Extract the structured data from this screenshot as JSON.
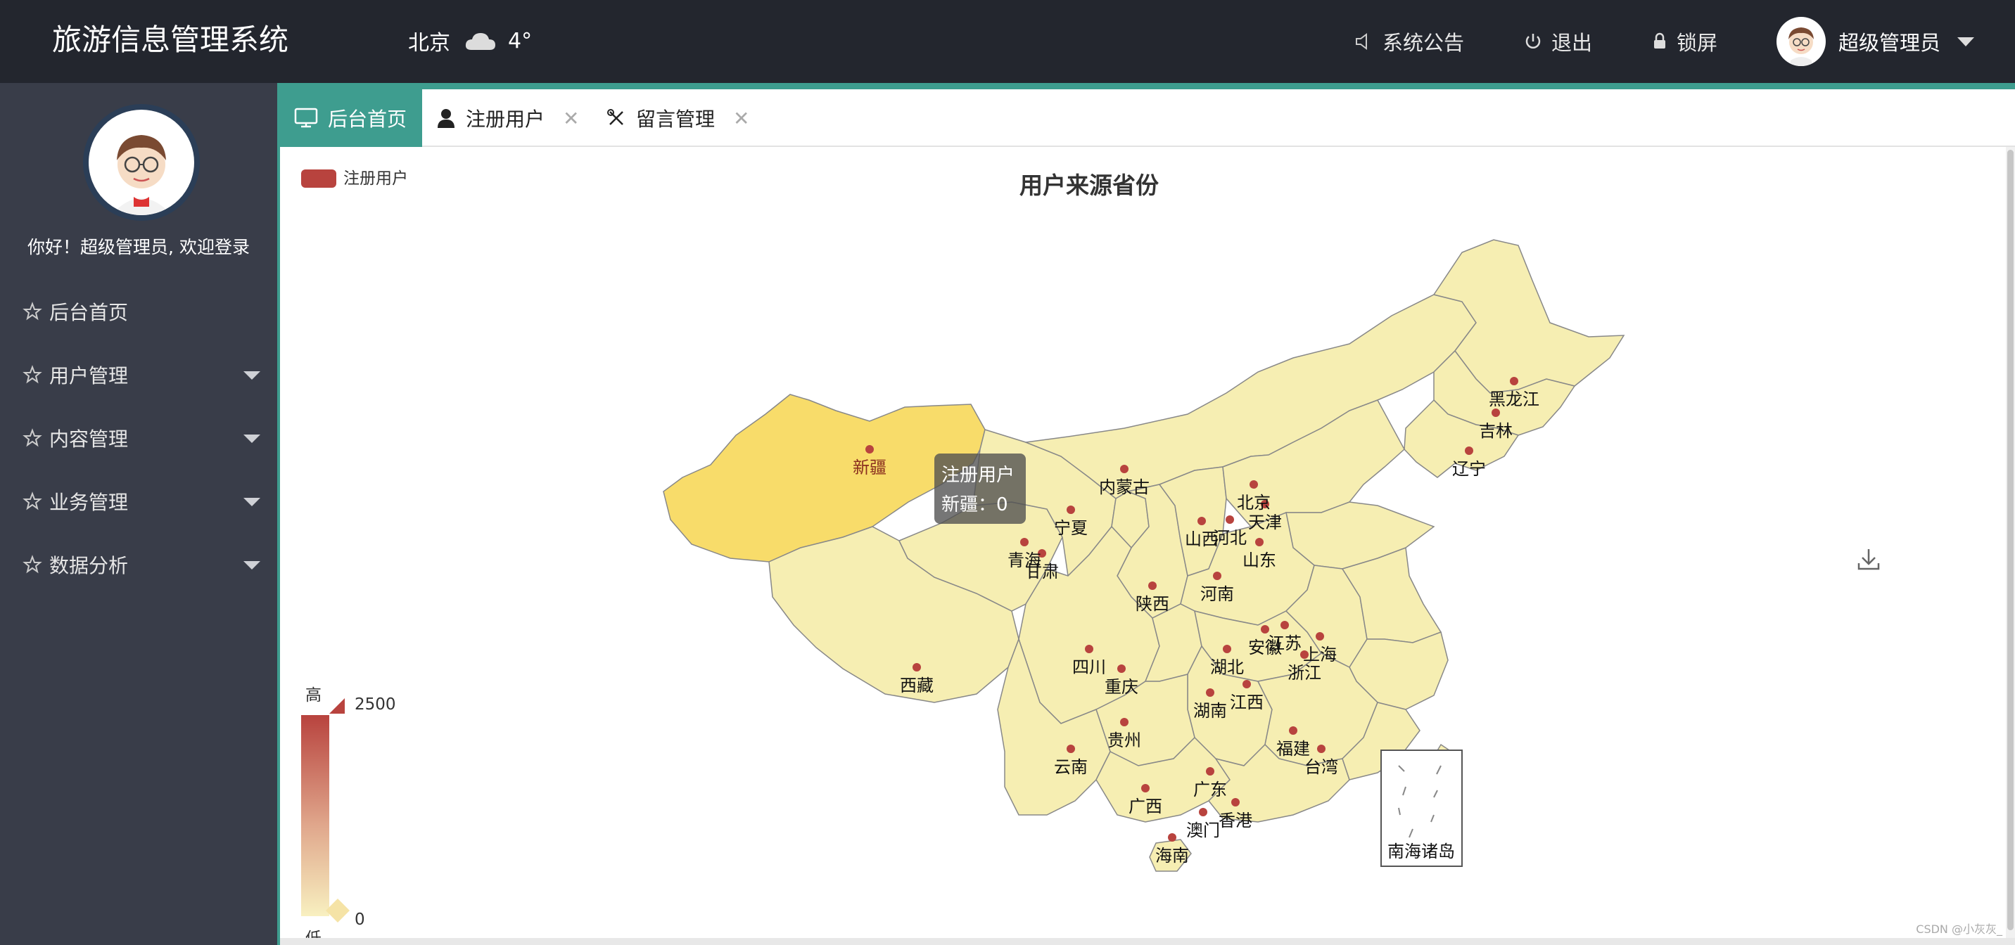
{
  "header": {
    "brand": "旅游信息管理系统",
    "city": "北京",
    "temperature": "4°",
    "weather_icon": "cloud-icon",
    "links": {
      "announcement": "系统公告",
      "logout": "退出",
      "lock": "锁屏"
    },
    "user_name": "超级管理员"
  },
  "sidebar": {
    "welcome": "你好！超级管理员, 欢迎登录",
    "items": [
      {
        "label": "后台首页",
        "has_submenu": false
      },
      {
        "label": "用户管理",
        "has_submenu": true
      },
      {
        "label": "内容管理",
        "has_submenu": true
      },
      {
        "label": "业务管理",
        "has_submenu": true
      },
      {
        "label": "数据分析",
        "has_submenu": true
      }
    ]
  },
  "tabs": [
    {
      "label": "后台首页",
      "active": true,
      "closable": false
    },
    {
      "label": "注册用户",
      "active": false,
      "closable": true
    },
    {
      "label": "留言管理",
      "active": false,
      "closable": true
    }
  ],
  "colors": {
    "accent": "#3e9d8f",
    "header_bg": "#23262e",
    "sidebar_bg": "#393d49",
    "series": "#b8433e",
    "region_fill": "#f5eeb0",
    "region_highlight": "#f8dc6a"
  },
  "chart_data": {
    "type": "map",
    "title": "用户来源省份",
    "legend": [
      "注册用户"
    ],
    "series": [
      {
        "name": "注册用户",
        "data": [
          {
            "name": "新疆",
            "value": 0
          },
          {
            "name": "西藏",
            "value": 0
          },
          {
            "name": "青海",
            "value": 0
          },
          {
            "name": "甘肃",
            "value": 0
          },
          {
            "name": "宁夏",
            "value": 0
          },
          {
            "name": "内蒙古",
            "value": 0
          },
          {
            "name": "黑龙江",
            "value": 0
          },
          {
            "name": "吉林",
            "value": 0
          },
          {
            "name": "辽宁",
            "value": 0
          },
          {
            "name": "北京",
            "value": 0
          },
          {
            "name": "天津",
            "value": 0
          },
          {
            "name": "河北",
            "value": 0
          },
          {
            "name": "山西",
            "value": 0
          },
          {
            "name": "山东",
            "value": 0
          },
          {
            "name": "陕西",
            "value": 0
          },
          {
            "name": "河南",
            "value": 0
          },
          {
            "name": "四川",
            "value": 0
          },
          {
            "name": "重庆",
            "value": 0
          },
          {
            "name": "湖北",
            "value": 0
          },
          {
            "name": "安徽",
            "value": 0
          },
          {
            "name": "江苏",
            "value": 0
          },
          {
            "name": "上海",
            "value": 0
          },
          {
            "name": "浙江",
            "value": 0
          },
          {
            "name": "湖南",
            "value": 0
          },
          {
            "name": "江西",
            "value": 0
          },
          {
            "name": "贵州",
            "value": 0
          },
          {
            "name": "云南",
            "value": 0
          },
          {
            "name": "广西",
            "value": 0
          },
          {
            "name": "广东",
            "value": 0
          },
          {
            "name": "福建",
            "value": 0
          },
          {
            "name": "台湾",
            "value": 0
          },
          {
            "name": "香港",
            "value": 0
          },
          {
            "name": "澳门",
            "value": 0
          },
          {
            "name": "海南",
            "value": 0
          }
        ]
      }
    ],
    "visual_map": {
      "min": 0,
      "max": 2500,
      "high_text": "高",
      "low_text": "低"
    },
    "tooltip": {
      "series": "注册用户",
      "text": "新疆：0"
    },
    "inset_label": "南海诸岛",
    "highlighted_region": "新疆"
  },
  "watermark": "CSDN @小灰灰_"
}
